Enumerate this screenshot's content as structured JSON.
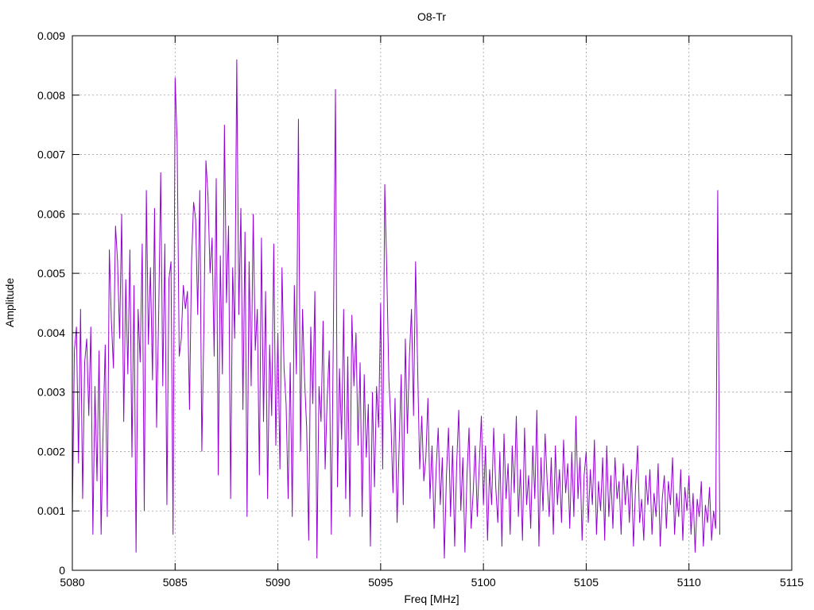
{
  "chart_data": {
    "type": "line",
    "title": "O8-Tr",
    "xlabel": "Freq [MHz]",
    "ylabel": "Amplitude",
    "xlim": [
      5080,
      5115
    ],
    "ylim": [
      0,
      0.009
    ],
    "x_ticks": [
      "5080",
      "5085",
      "5090",
      "5095",
      "5100",
      "5105",
      "5110",
      "5115"
    ],
    "y_ticks": [
      "0",
      "0.001",
      "0.002",
      "0.003",
      "0.004",
      "0.005",
      "0.006",
      "0.007",
      "0.008",
      "0.009"
    ],
    "grid": true,
    "legend": "none",
    "line_color": "#9400d3",
    "series": [
      {
        "x_start": 5080.0,
        "x_step": 0.1,
        "values": [
          0.0009,
          0.0037,
          0.0041,
          0.0018,
          0.0044,
          0.0012,
          0.0035,
          0.0039,
          0.0026,
          0.0041,
          0.0006,
          0.0031,
          0.0015,
          0.0037,
          0.0006,
          0.0024,
          0.0038,
          0.0009,
          0.0054,
          0.0042,
          0.0034,
          0.0058,
          0.0052,
          0.0039,
          0.006,
          0.0025,
          0.0049,
          0.0033,
          0.0054,
          0.0019,
          0.0048,
          0.0003,
          0.0044,
          0.0035,
          0.0055,
          0.001,
          0.0064,
          0.0038,
          0.0051,
          0.0032,
          0.0061,
          0.0024,
          0.0043,
          0.0067,
          0.0031,
          0.0055,
          0.0011,
          0.0049,
          0.0052,
          0.0006,
          0.0083,
          0.0072,
          0.0036,
          0.0039,
          0.0048,
          0.0044,
          0.0047,
          0.0027,
          0.0052,
          0.0062,
          0.0059,
          0.0043,
          0.0064,
          0.002,
          0.0041,
          0.0069,
          0.0063,
          0.005,
          0.0056,
          0.0036,
          0.0066,
          0.0016,
          0.0053,
          0.0033,
          0.0075,
          0.0045,
          0.0058,
          0.0012,
          0.0051,
          0.0039,
          0.0086,
          0.0043,
          0.0061,
          0.0027,
          0.0057,
          0.0009,
          0.0052,
          0.0031,
          0.006,
          0.0037,
          0.0044,
          0.0016,
          0.0056,
          0.0025,
          0.0047,
          0.0012,
          0.0038,
          0.0026,
          0.0055,
          0.0021,
          0.004,
          0.0017,
          0.0051,
          0.0034,
          0.0028,
          0.0012,
          0.0035,
          0.0009,
          0.0048,
          0.0033,
          0.0076,
          0.002,
          0.0044,
          0.0032,
          0.0024,
          0.0005,
          0.0041,
          0.0028,
          0.0047,
          0.0002,
          0.0031,
          0.0025,
          0.0042,
          0.0017,
          0.0029,
          0.0037,
          0.0006,
          0.004,
          0.0081,
          0.0014,
          0.0034,
          0.0022,
          0.0044,
          0.0012,
          0.0036,
          0.0009,
          0.0043,
          0.0031,
          0.004,
          0.0021,
          0.0035,
          0.0009,
          0.0033,
          0.0019,
          0.0028,
          0.0004,
          0.003,
          0.0014,
          0.0031,
          0.0024,
          0.0045,
          0.0017,
          0.0065,
          0.005,
          0.0032,
          0.0025,
          0.0013,
          0.0029,
          0.0008,
          0.0021,
          0.0033,
          0.0011,
          0.0039,
          0.0023,
          0.0036,
          0.0044,
          0.0026,
          0.0052,
          0.0034,
          0.0017,
          0.0026,
          0.0015,
          0.0019,
          0.0029,
          0.0012,
          0.0021,
          0.0007,
          0.0017,
          0.0024,
          0.0011,
          0.0019,
          0.0002,
          0.0016,
          0.0024,
          0.0009,
          0.0021,
          0.0004,
          0.0018,
          0.0027,
          0.001,
          0.0019,
          0.0003,
          0.0016,
          0.0024,
          0.0007,
          0.0013,
          0.0021,
          0.0009,
          0.0018,
          0.0026,
          0.0011,
          0.0021,
          0.0005,
          0.0017,
          0.0011,
          0.0024,
          0.0014,
          0.0008,
          0.002,
          0.0004,
          0.0023,
          0.0012,
          0.0018,
          0.0006,
          0.0021,
          0.0013,
          0.0026,
          0.0009,
          0.0017,
          0.0005,
          0.0024,
          0.0011,
          0.0016,
          0.0007,
          0.0021,
          0.0012,
          0.0027,
          0.0004,
          0.0019,
          0.001,
          0.0023,
          0.0015,
          0.0009,
          0.0019,
          0.0006,
          0.0021,
          0.0011,
          0.0017,
          0.0008,
          0.0022,
          0.0013,
          0.0018,
          0.0007,
          0.002,
          0.0009,
          0.0026,
          0.0012,
          0.0019,
          0.0005,
          0.0016,
          0.002,
          0.0008,
          0.0017,
          0.0011,
          0.0022,
          0.0006,
          0.0015,
          0.001,
          0.0019,
          0.0005,
          0.0021,
          0.0009,
          0.0016,
          0.0007,
          0.0019,
          0.0012,
          0.0015,
          0.0006,
          0.0018,
          0.0011,
          0.0016,
          0.0008,
          0.0017,
          0.0004,
          0.0014,
          0.0021,
          0.0008,
          0.0012,
          0.0005,
          0.0016,
          0.0011,
          0.0017,
          0.0006,
          0.0013,
          0.0009,
          0.0018,
          0.0004,
          0.0012,
          0.0016,
          0.0007,
          0.0015,
          0.0011,
          0.0019,
          0.0006,
          0.0013,
          0.0009,
          0.0017,
          0.0005,
          0.0014,
          0.001,
          0.0016,
          0.0006,
          0.0013,
          0.0003,
          0.0012,
          0.0009,
          0.0015,
          0.0004,
          0.0011,
          0.0008,
          0.0014,
          0.0005,
          0.001,
          0.0007,
          0.0064,
          0.0006
        ]
      }
    ]
  }
}
